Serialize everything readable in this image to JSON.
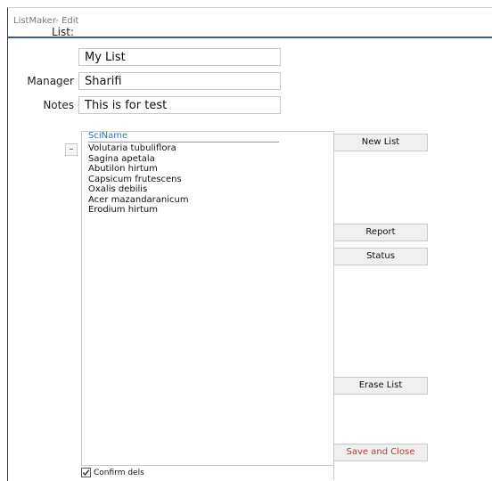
{
  "window": {
    "title": "ListMaker- Edit"
  },
  "form": {
    "list_label": "List:",
    "list_value": "My List",
    "manager_label": "Manager",
    "manager_value": "Sharifi",
    "notes_label": "Notes",
    "notes_value": "This is for test"
  },
  "list": {
    "column_header": "SciName",
    "remove_label": "–",
    "items": [
      "Volutaria tubuliflora",
      "Sagina apetala",
      "Abutilon hirtum",
      "Capsicum frutescens",
      "Oxalis debilis",
      "Acer mazandaranicum",
      "Erodium hirtum"
    ]
  },
  "buttons": {
    "new_list": "New List",
    "report": "Report",
    "status": "Status",
    "erase_list": "Erase List",
    "save_and_close": "Save and Close"
  },
  "confirm": {
    "label": "Confirm dels",
    "checked": true
  },
  "colors": {
    "accent": "#3c5f86",
    "danger": "#c0392b",
    "header_text": "#3a6fb0"
  }
}
